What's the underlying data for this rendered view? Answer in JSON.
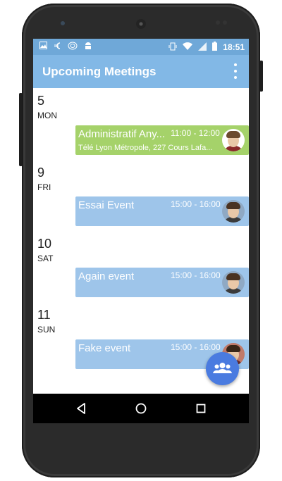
{
  "status_bar": {
    "time": "18:51",
    "left_icons": [
      "image-icon",
      "euro-icon",
      "wifi-ring-icon",
      "android-icon"
    ],
    "right_icons": [
      "vibrate-icon",
      "wifi-icon",
      "signal-icon",
      "battery-icon"
    ]
  },
  "app_bar": {
    "title": "Upcoming Meetings",
    "overflow_icon": "overflow-menu-icon"
  },
  "days": [
    {
      "number": "5",
      "name": "MON",
      "events": [
        {
          "title": "Administratif Any...",
          "time": "11:00 - 12:00",
          "location": "Télé Lyon Métropole, 227 Cours Lafa...",
          "color": "#a5d26a",
          "avatar": "person-avatar"
        }
      ]
    },
    {
      "number": "9",
      "name": "FRI",
      "events": [
        {
          "title": "Essai Event",
          "time": "15:00 - 16:00",
          "location": "",
          "color": "#9ec5ea",
          "avatar": "person-avatar"
        }
      ]
    },
    {
      "number": "10",
      "name": "SAT",
      "events": [
        {
          "title": "Again event",
          "time": "15:00 - 16:00",
          "location": "",
          "color": "#9ec5ea",
          "avatar": "person-avatar"
        }
      ]
    },
    {
      "number": "11",
      "name": "SUN",
      "events": [
        {
          "title": "Fake event",
          "time": "15:00 - 16:00",
          "location": "",
          "color": "#9ec5ea",
          "avatar": "person-avatar"
        }
      ]
    }
  ],
  "fab": {
    "icon": "group-icon",
    "color": "#4a7be0"
  },
  "nav_bar": {
    "buttons": [
      "back-icon",
      "home-icon",
      "recents-icon"
    ]
  },
  "colors": {
    "status_bar": "#6fa8d8",
    "app_bar": "#82b8e6"
  }
}
